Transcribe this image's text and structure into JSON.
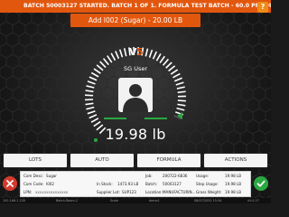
{
  "banner": {
    "text": "BATCH 50003127 STARTED. BATCH 1 OF 1. FORMULA TEST BATCH - 60.0 PRODUCTS",
    "help_label": "?"
  },
  "add_bar": {
    "text": "Add I002 (Sugar) - 20.00 LB"
  },
  "logo": {
    "v": "V",
    "s": "5"
  },
  "user": {
    "name": "SG User"
  },
  "scale": {
    "weight": "19.98 lb",
    "fill_fraction": 0.999
  },
  "buttons": {
    "lots": "LOTS",
    "auto": "AUTO",
    "formula": "FORMULA",
    "actions": "ACTIONS"
  },
  "info": {
    "com_desc_label": "Com Desc:",
    "com_desc_value": "Sugar",
    "com_code_label": "Com Code:",
    "com_code_value": "I002",
    "lpn_label": "LPN:",
    "lpn_value": "xxxxxxxxxxxxxxx",
    "in_stock_label": "In Stock:",
    "in_stock_value": "1473.93 LB",
    "supplier_lot_label": "Supplier Lot:",
    "supplier_lot_value": "SUP123",
    "job_label": "Job:",
    "job_value": "200722-6836",
    "batch_label": "Batch:",
    "batch_value": "50003127",
    "location_label": "Location:",
    "location_value": "MANUFACTURIN...",
    "usage_label": "Usage:",
    "usage_value": "19.98 LB",
    "step_usage_label": "Step Usage:",
    "step_usage_value": "19.98 LB",
    "gross_weight_label": "Gross Weight:",
    "gross_weight_value": "19.98 LB"
  },
  "status_bar": {
    "ip": "192.168.1.128",
    "station": "Batch-Room-1",
    "scale": "Scale",
    "user": "demo1",
    "datetime": "08/07/2020 15:54",
    "version": "v5.0.27"
  },
  "colors": {
    "accent": "#e2570e",
    "ok": "#2aa842",
    "cancel": "#d33a2c",
    "target_band": "#2aa842"
  }
}
